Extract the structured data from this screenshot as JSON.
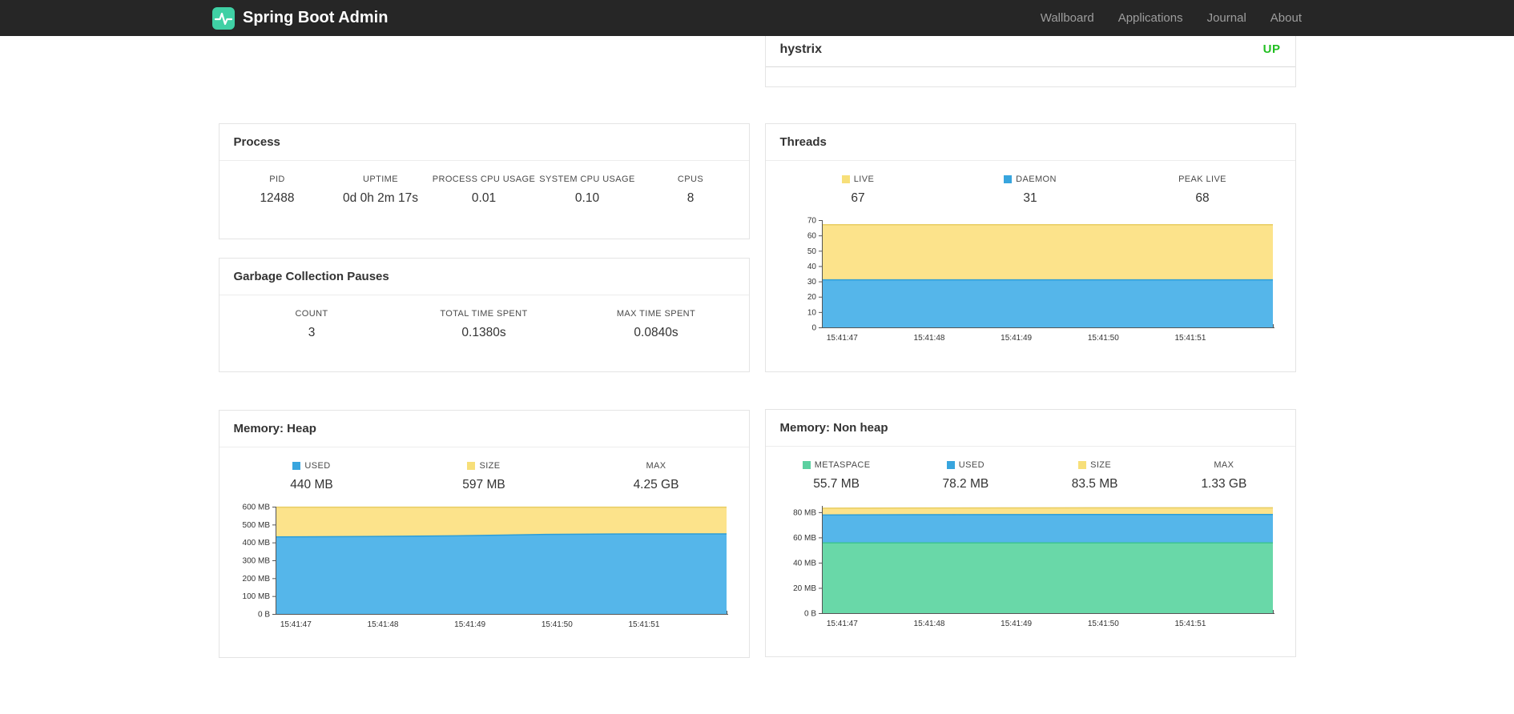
{
  "navbar": {
    "brand": "Spring Boot Admin",
    "items": [
      {
        "label": "Wallboard"
      },
      {
        "label": "Applications"
      },
      {
        "label": "Journal"
      },
      {
        "label": "About"
      }
    ]
  },
  "colors": {
    "up_green": "#21bf21",
    "logo_green": "#3fd0a4",
    "yellow": "#f7df79",
    "blue": "#38a5de",
    "green": "#5bd0a0"
  },
  "applications_card": {
    "rows": [
      {
        "name": "hystrix",
        "status": "UP"
      }
    ]
  },
  "process": {
    "title": "Process",
    "metrics": [
      {
        "label": "PID",
        "value": "12488"
      },
      {
        "label": "UPTIME",
        "value": "0d 0h 2m 17s"
      },
      {
        "label": "PROCESS CPU USAGE",
        "value": "0.01"
      },
      {
        "label": "SYSTEM CPU USAGE",
        "value": "0.10"
      },
      {
        "label": "CPUS",
        "value": "8"
      }
    ]
  },
  "gc": {
    "title": "Garbage Collection Pauses",
    "metrics": [
      {
        "label": "COUNT",
        "value": "3"
      },
      {
        "label": "TOTAL TIME SPENT",
        "value": "0.1380s"
      },
      {
        "label": "MAX TIME SPENT",
        "value": "0.0840s"
      }
    ]
  },
  "threads": {
    "title": "Threads",
    "legend": [
      {
        "label": "LIVE",
        "value": "67",
        "color": "#f7df79"
      },
      {
        "label": "DAEMON",
        "value": "31",
        "color": "#38a5de"
      },
      {
        "label": "PEAK LIVE",
        "value": "68",
        "color": null
      }
    ]
  },
  "memory_heap": {
    "title": "Memory: Heap",
    "legend": [
      {
        "label": "USED",
        "value": "440 MB",
        "color": "#38a5de"
      },
      {
        "label": "SIZE",
        "value": "597 MB",
        "color": "#f7df79"
      },
      {
        "label": "MAX",
        "value": "4.25 GB",
        "color": null
      }
    ]
  },
  "memory_nonheap": {
    "title": "Memory: Non heap",
    "legend": [
      {
        "label": "METASPACE",
        "value": "55.7 MB",
        "color": "#5bd0a0"
      },
      {
        "label": "USED",
        "value": "78.2 MB",
        "color": "#38a5de"
      },
      {
        "label": "SIZE",
        "value": "83.5 MB",
        "color": "#f7df79"
      },
      {
        "label": "MAX",
        "value": "1.33 GB",
        "color": null
      }
    ]
  },
  "chart_data": [
    {
      "id": "threads-chart",
      "type": "area",
      "title": "Threads",
      "x": [
        "15:41:47",
        "15:41:48",
        "15:41:49",
        "15:41:50",
        "15:41:51"
      ],
      "ylim": [
        0,
        70
      ],
      "yscale_max": 70,
      "grid": false,
      "yticks": [
        {
          "value": 0,
          "label": "0"
        },
        {
          "value": 10,
          "label": "10"
        },
        {
          "value": 20,
          "label": "20"
        },
        {
          "value": 30,
          "label": "30"
        },
        {
          "value": 40,
          "label": "40"
        },
        {
          "value": 50,
          "label": "50"
        },
        {
          "value": 60,
          "label": "60"
        },
        {
          "value": 70,
          "label": "70"
        }
      ],
      "xlabels": [
        {
          "f": 0.045,
          "label": "15:41:47"
        },
        {
          "f": 0.238,
          "label": "15:41:48"
        },
        {
          "f": 0.431,
          "label": "15:41:49"
        },
        {
          "f": 0.624,
          "label": "15:41:50"
        },
        {
          "f": 0.817,
          "label": "15:41:51"
        }
      ],
      "series": [
        {
          "name": "live",
          "color": "#fce38b",
          "line": "#e8cd62",
          "values": [
            67,
            67,
            67,
            67,
            67,
            67
          ]
        },
        {
          "name": "daemon",
          "color": "#55b6ea",
          "line": "#2d9ed8",
          "values": [
            31,
            31,
            31,
            31,
            31,
            31
          ]
        }
      ]
    },
    {
      "id": "memory-heap-chart",
      "type": "area",
      "title": "Memory: Heap",
      "x": [
        "15:41:47",
        "15:41:48",
        "15:41:49",
        "15:41:50",
        "15:41:51"
      ],
      "ylim": [
        0,
        600
      ],
      "yscale_max": 600,
      "grid": false,
      "yticks": [
        {
          "value": 0,
          "label": "0 B"
        },
        {
          "value": 100,
          "label": "100 MB"
        },
        {
          "value": 200,
          "label": "200 MB"
        },
        {
          "value": 300,
          "label": "300 MB"
        },
        {
          "value": 400,
          "label": "400 MB"
        },
        {
          "value": 500,
          "label": "500 MB"
        },
        {
          "value": 600,
          "label": "600 MB"
        }
      ],
      "xlabels": [
        {
          "f": 0.045,
          "label": "15:41:47"
        },
        {
          "f": 0.238,
          "label": "15:41:48"
        },
        {
          "f": 0.431,
          "label": "15:41:49"
        },
        {
          "f": 0.624,
          "label": "15:41:50"
        },
        {
          "f": 0.817,
          "label": "15:41:51"
        }
      ],
      "series": [
        {
          "name": "size",
          "color": "#fce38b",
          "line": "#e8cd62",
          "values": [
            597,
            597,
            597,
            597,
            597,
            597
          ]
        },
        {
          "name": "used",
          "color": "#55b6ea",
          "line": "#2d9ed8",
          "values": [
            431,
            433,
            437,
            445,
            448,
            448
          ]
        }
      ]
    },
    {
      "id": "memory-nonheap-chart",
      "type": "area",
      "title": "Memory: Non heap",
      "x": [
        "15:41:47",
        "15:41:48",
        "15:41:49",
        "15:41:50",
        "15:41:51"
      ],
      "ylim": [
        0,
        85
      ],
      "yscale_max": 85,
      "grid": false,
      "yticks": [
        {
          "value": 0,
          "label": "0 B"
        },
        {
          "value": 20,
          "label": "20 MB"
        },
        {
          "value": 40,
          "label": "40 MB"
        },
        {
          "value": 60,
          "label": "60 MB"
        },
        {
          "value": 80,
          "label": "80 MB"
        }
      ],
      "xlabels": [
        {
          "f": 0.045,
          "label": "15:41:47"
        },
        {
          "f": 0.238,
          "label": "15:41:48"
        },
        {
          "f": 0.431,
          "label": "15:41:49"
        },
        {
          "f": 0.624,
          "label": "15:41:50"
        },
        {
          "f": 0.817,
          "label": "15:41:51"
        }
      ],
      "series": [
        {
          "name": "size",
          "color": "#fce38b",
          "line": "#e8cd62",
          "values": [
            83.2,
            83.3,
            83.4,
            83.5,
            83.5,
            83.5
          ]
        },
        {
          "name": "used",
          "color": "#55b6ea",
          "line": "#2d9ed8",
          "values": [
            77.8,
            78.0,
            78.1,
            78.2,
            78.2,
            78.2
          ]
        },
        {
          "name": "metaspace",
          "color": "#69d8a8",
          "line": "#3ec68e",
          "values": [
            55.7,
            55.7,
            55.7,
            55.7,
            55.7,
            55.7
          ]
        }
      ]
    }
  ]
}
